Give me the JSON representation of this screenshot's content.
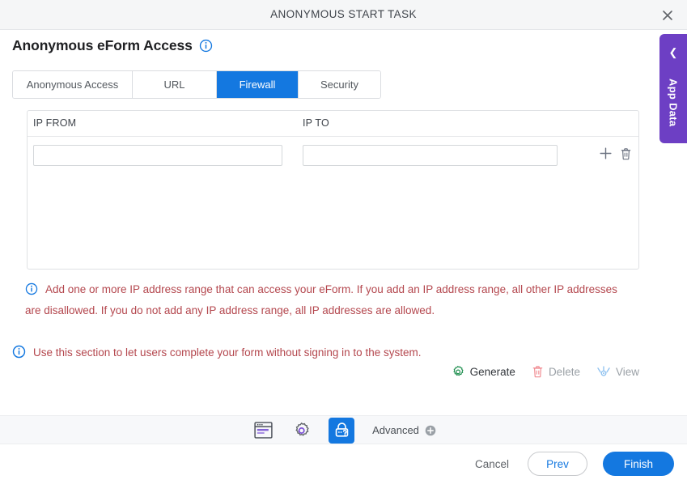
{
  "window": {
    "title": "ANONYMOUS START TASK",
    "close_icon": "close-icon"
  },
  "header": {
    "title": "Anonymous eForm Access",
    "info_icon": "info-circle-icon"
  },
  "tabs": [
    {
      "label": "Anonymous Access",
      "active": false
    },
    {
      "label": "URL",
      "active": false
    },
    {
      "label": "Firewall",
      "active": true
    },
    {
      "label": "Security",
      "active": false
    }
  ],
  "grid": {
    "columns": [
      "IP FROM",
      "IP TO"
    ],
    "rows": [
      {
        "ip_from": "",
        "ip_to": "",
        "ip_from_placeholder": "",
        "ip_to_placeholder": "",
        "add_icon": "plus-icon",
        "delete_icon": "trash-icon"
      }
    ]
  },
  "notes": {
    "firewall_note": "Add one or more IP address range that can access your eForm. If you add an IP address range, all other IP addresses are disallowed. If you do not add any IP address range, all IP addresses are allowed.",
    "section_note": "Use this section to let users complete your form without signing in to the system."
  },
  "actions": [
    {
      "label": "Generate",
      "icon": "gear-icon",
      "enabled": true
    },
    {
      "label": "Delete",
      "icon": "trash-icon",
      "enabled": false
    },
    {
      "label": "View",
      "icon": "view-icon",
      "enabled": false
    }
  ],
  "toolbar": {
    "form_icon": "form-window-icon",
    "settings_icon": "gear-icon",
    "anonymous_access_icon": "lock-question-icon",
    "advanced_label": "Advanced",
    "advanced_icon": "plus-circle-icon"
  },
  "footer": {
    "cancel_label": "Cancel",
    "prev_label": "Prev",
    "finish_label": "Finish"
  },
  "side_panel": {
    "label": "App Data",
    "collapse_icon": "chevron-left-icon"
  },
  "colors": {
    "accent_blue": "#1478e0",
    "purple": "#6d3fc4",
    "note_red": "#b4474e",
    "green": "#1e8e4e",
    "disabled_gray": "#9aa0a6"
  }
}
